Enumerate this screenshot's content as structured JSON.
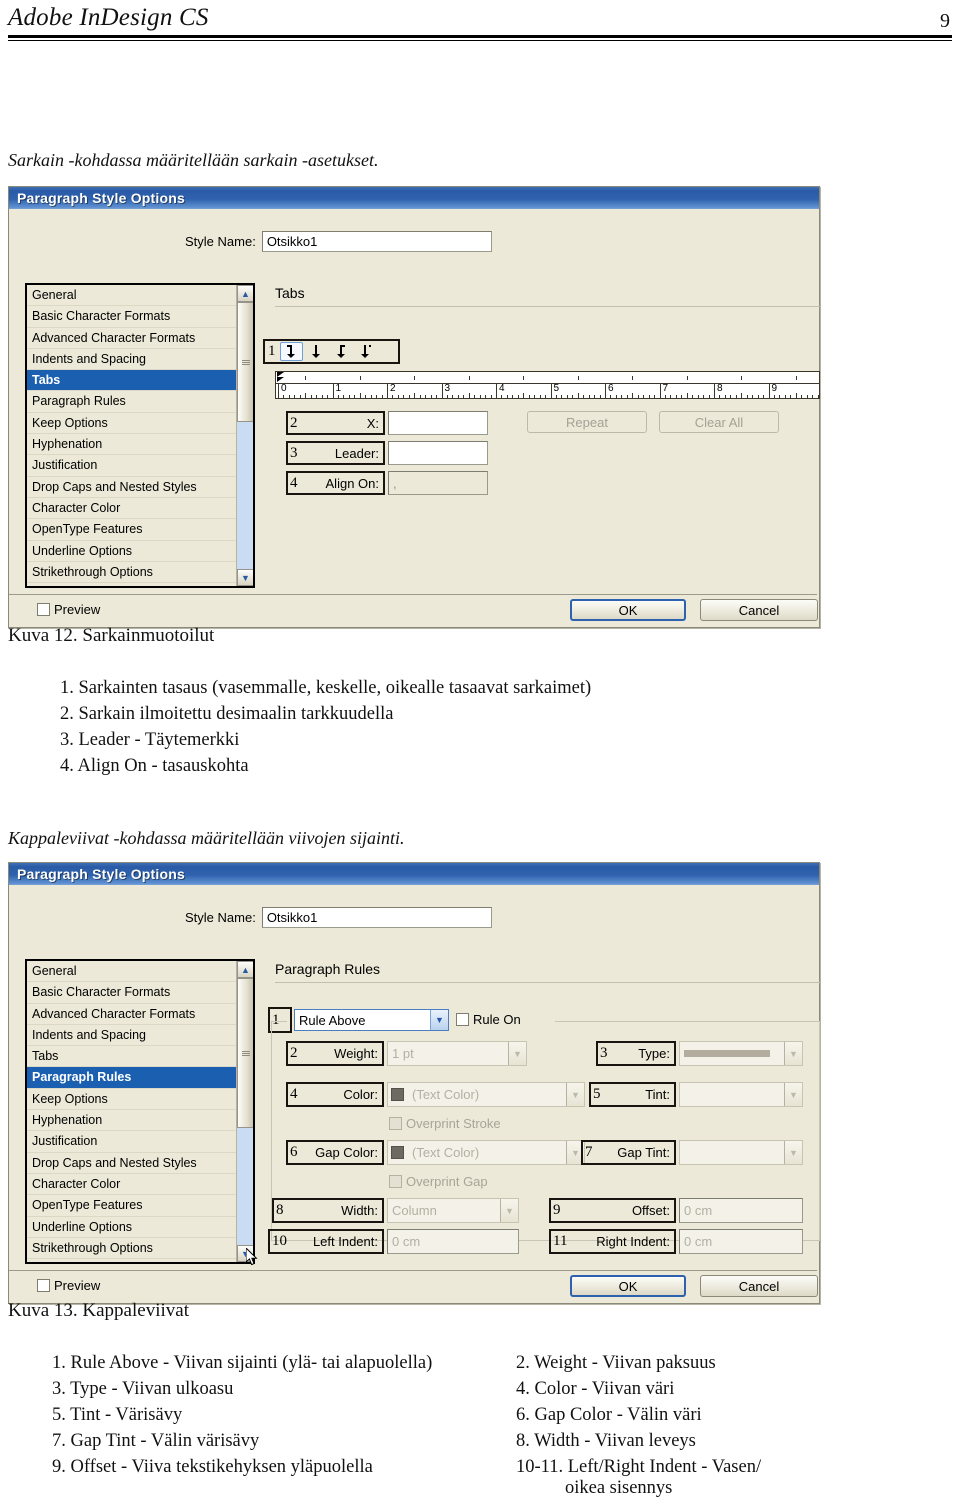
{
  "page": {
    "doc_title": "Adobe InDesign CS",
    "page_number": "9"
  },
  "intro_1": "Sarkain -kohdassa määritellään sarkain -asetukset.",
  "intro_2": "Kappaleviivat -kohdassa määritellään viivojen sijainti.",
  "dialog_tabs": {
    "title": "Paragraph Style Options",
    "style_name_label": "Style Name:",
    "style_name_value": "Otsikko1",
    "categories": [
      "General",
      "Basic Character Formats",
      "Advanced Character Formats",
      "Indents and Spacing",
      "Tabs",
      "Paragraph Rules",
      "Keep Options",
      "Hyphenation",
      "Justification",
      "Drop Caps and Nested Styles",
      "Character Color",
      "OpenType Features",
      "Underline Options",
      "Strikethrough Options"
    ],
    "selected_category": "Tabs",
    "pane_title": "Tabs",
    "callout_1": "1",
    "tab_align_buttons": [
      "left-justified-tab-icon",
      "center-justified-tab-icon",
      "right-justified-tab-icon",
      "decimal-align-tab-icon"
    ],
    "ruler_labels": [
      "0",
      "1",
      "2",
      "3",
      "4",
      "5",
      "6",
      "7",
      "8",
      "9"
    ],
    "fields": [
      {
        "num": "2",
        "label": "X:",
        "value": ""
      },
      {
        "num": "3",
        "label": "Leader:",
        "value": ""
      },
      {
        "num": "4",
        "label": "Align On:",
        "value": ","
      }
    ],
    "repeat_button": "Repeat",
    "clear_all_button": "Clear All",
    "preview_label": "Preview",
    "ok_button": "OK",
    "cancel_button": "Cancel"
  },
  "caption_12": "Kuva 12. Sarkainmuotoilut",
  "list_12": [
    "1. Sarkainten tasaus (vasemmalle, keskelle, oikealle tasaavat sarkaimet)",
    "2. Sarkain ilmoitettu desimaalin tarkkuudella",
    "3. Leader - Täytemerkki",
    "4. Align On - tasauskohta"
  ],
  "dialog_rules": {
    "title": "Paragraph Style Options",
    "style_name_label": "Style Name:",
    "style_name_value": "Otsikko1",
    "categories": [
      "General",
      "Basic Character Formats",
      "Advanced Character Formats",
      "Indents and Spacing",
      "Tabs",
      "Paragraph Rules",
      "Keep Options",
      "Hyphenation",
      "Justification",
      "Drop Caps and Nested Styles",
      "Character Color",
      "OpenType Features",
      "Underline Options",
      "Strikethrough Options"
    ],
    "selected_category": "Paragraph Rules",
    "pane_title": "Paragraph Rules",
    "rule_position": {
      "num": "1",
      "value": "Rule Above"
    },
    "rule_on": {
      "label": "Rule On",
      "checked": false
    },
    "weight": {
      "num": "2",
      "label": "Weight:",
      "value": "1 pt"
    },
    "type": {
      "num": "3",
      "label": "Type:",
      "value": "solid-line-preview"
    },
    "color": {
      "num": "4",
      "label": "Color:",
      "value": "(Text Color)"
    },
    "tint": {
      "num": "5",
      "label": "Tint:",
      "value": ""
    },
    "overprint_stroke": "Overprint Stroke",
    "gap_color": {
      "num": "6",
      "label": "Gap Color:",
      "value": "(Text Color)"
    },
    "gap_tint": {
      "num": "7",
      "label": "Gap Tint:",
      "value": ""
    },
    "overprint_gap": "Overprint Gap",
    "width": {
      "num": "8",
      "label": "Width:",
      "value": "Column"
    },
    "offset": {
      "num": "9",
      "label": "Offset:",
      "value": "0 cm"
    },
    "left_indent": {
      "num": "10",
      "label": "Left Indent:",
      "value": "0 cm"
    },
    "right_indent": {
      "num": "11",
      "label": "Right Indent:",
      "value": "0 cm"
    },
    "preview_label": "Preview",
    "ok_button": "OK",
    "cancel_button": "Cancel"
  },
  "caption_13": "Kuva 13. Kappaleviivat",
  "list_13_left": [
    "1. Rule Above - Viivan sijainti (ylä- tai alapuolella)",
    "3. Type - Viivan ulkoasu",
    "5. Tint - Värisävy",
    "7. Gap Tint - Välin värisävy",
    "9. Offset - Viiva tekstikehyksen yläpuolella"
  ],
  "list_13_right": [
    "2. Weight - Viivan paksuus",
    "4. Color - Viivan väri",
    "6. Gap Color - Välin väri",
    "8. Width - Viivan leveys",
    "10-11. Left/Right Indent - Vasen/"
  ],
  "list_13_right_cont": "oikea sisennys",
  "colors": {
    "titlebar_blue": "#2a5aa5",
    "selection_blue": "#1b5fb0",
    "dialog_face": "#ece9d8",
    "disabled_text": "#b3afa2"
  }
}
